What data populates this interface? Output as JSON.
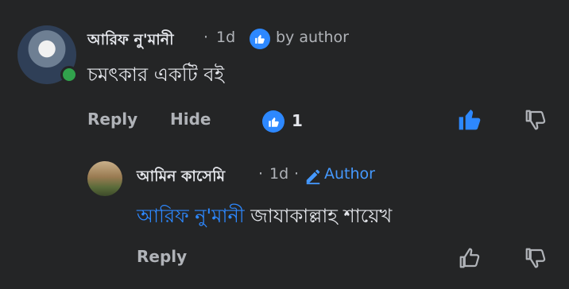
{
  "comment": {
    "author": "আরিফ নু'মানী",
    "time": "1d",
    "author_tag": "by author",
    "text": "চমৎকার একটি বই",
    "actions": {
      "reply": "Reply",
      "hide": "Hide"
    },
    "reaction_count": "1"
  },
  "reply": {
    "author": "আমিন কাসেমি",
    "time": "1d",
    "author_badge": "Author",
    "mention": "আরিফ নু'মানী",
    "text": "জাযাকাল্লাহ শায়েখ",
    "actions": {
      "reply": "Reply"
    }
  },
  "separator": "·",
  "colors": {
    "accent": "#2d88ff",
    "online": "#31a24c",
    "background": "#242526"
  }
}
